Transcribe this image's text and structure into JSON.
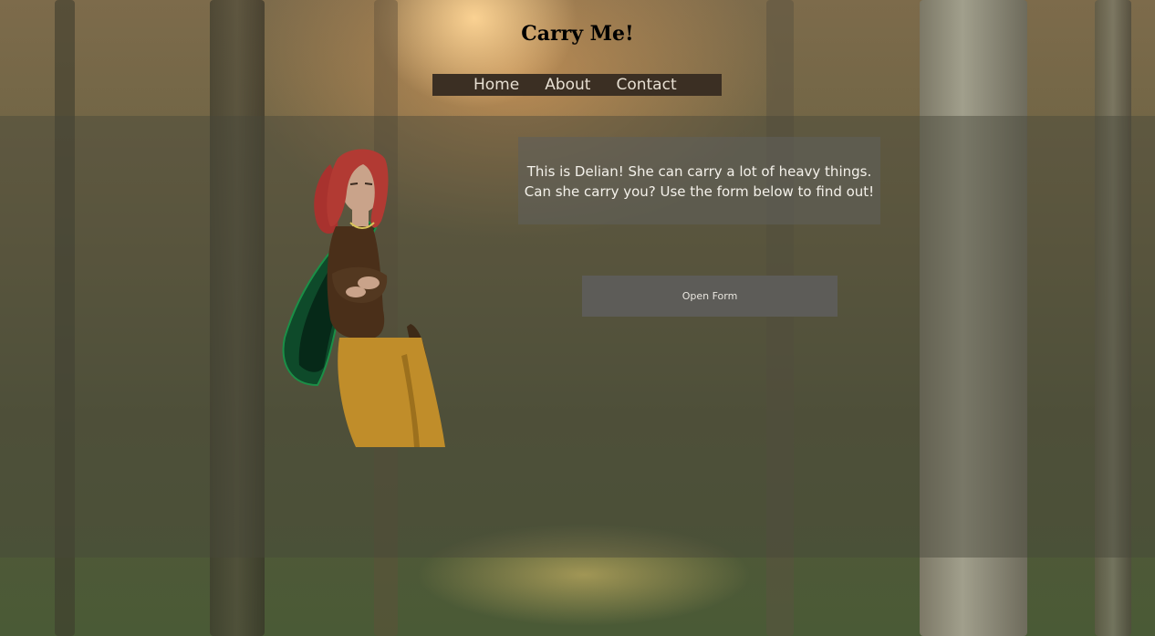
{
  "site": {
    "title": "Carry Me!"
  },
  "nav": {
    "items": [
      {
        "label": "Home"
      },
      {
        "label": "About"
      },
      {
        "label": "Contact"
      }
    ]
  },
  "intro": {
    "line1": "This is Delian! She can carry a lot of heavy things.",
    "line2": "Can she carry you? Use the form below to find out!"
  },
  "form": {
    "open_label": "Open Form"
  },
  "colors": {
    "nav_bg": "#3b2f23",
    "panel_overlay": "rgba(70,70,58,0.45)",
    "button_bg": "#5d5c58"
  },
  "icons": {
    "character": "delian-illustration"
  }
}
